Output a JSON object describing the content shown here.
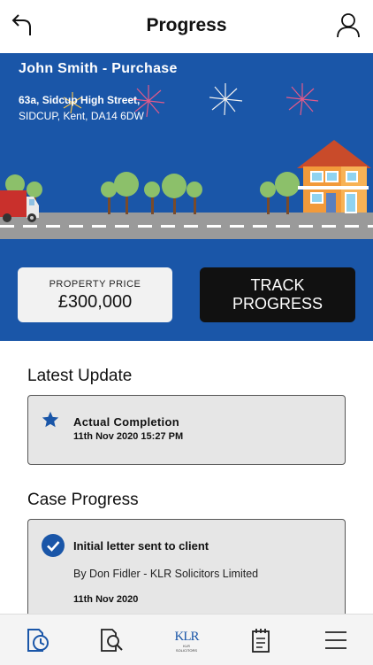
{
  "header": {
    "title": "Progress"
  },
  "property": {
    "name": "John Smith - Purchase",
    "address_line1": "63a, Sidcup High Street,",
    "address_line2": "SIDCUP, Kent, DA14 6DW"
  },
  "price": {
    "label": "PROPERTY PRICE",
    "value": "£300,000"
  },
  "track_button": {
    "line1": "TRACK",
    "line2": "PROGRESS"
  },
  "latest_update": {
    "heading": "Latest Update",
    "title": "Actual Completion",
    "timestamp": "11th Nov 2020 15:27 PM"
  },
  "case_progress": {
    "heading": "Case Progress",
    "items": [
      {
        "title": "Initial letter sent to client",
        "author": "By Don Fidler - KLR Solicitors Limited",
        "date": "11th Nov 2020"
      }
    ]
  },
  "bottom_nav": {
    "logo_text": "KLR",
    "logo_sub": "KLR SOLICITORS"
  },
  "colors": {
    "brand_blue": "#1a56a8",
    "dark": "#111111",
    "card_gray": "#e6e6e6"
  },
  "icons": [
    "back-arrow-icon",
    "user-icon",
    "star-icon",
    "check-circle-icon",
    "progress-clock-icon",
    "document-search-icon",
    "notepad-icon",
    "menu-icon"
  ]
}
